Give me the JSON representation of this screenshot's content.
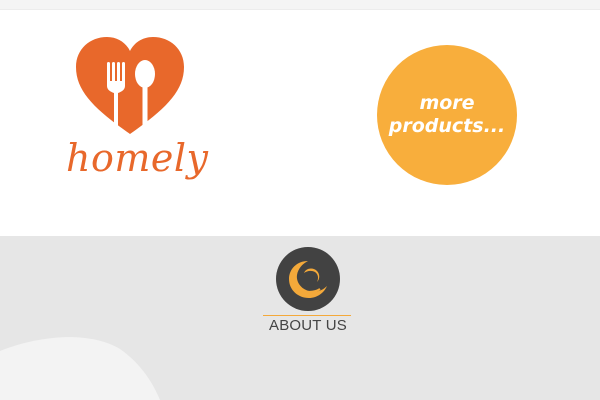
{
  "brand": {
    "name": "homely",
    "logo_icon": "heart-fork-spoon-icon",
    "colors": {
      "primary": "#e8682b"
    }
  },
  "products": {
    "more_button_label": "more\nproducts...",
    "colors": {
      "button_bg": "#f8ae3c",
      "button_text": "#ffffff"
    }
  },
  "about": {
    "emblem_icon": "crescent-swirl-icon",
    "heading": "ABOUT US",
    "colors": {
      "emblem_bg": "#424242",
      "emblem_mark": "#f4a93a",
      "section_bg": "#e6e6e6"
    }
  }
}
